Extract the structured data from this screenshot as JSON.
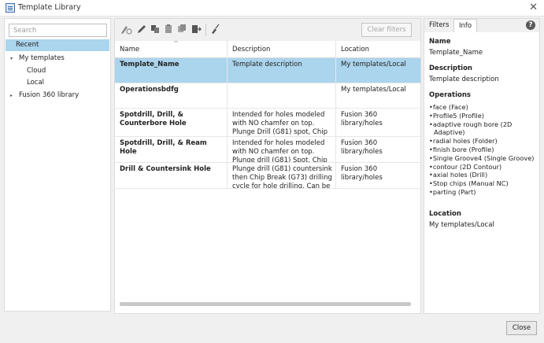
{
  "window": {
    "title": "Template Library",
    "close_glyph": "✕"
  },
  "search": {
    "placeholder": "Search",
    "value": ""
  },
  "tree": {
    "items": [
      {
        "label": "Recent",
        "selected": true
      },
      {
        "label": "My templates",
        "expander": "▾"
      },
      {
        "label": "Cloud"
      },
      {
        "label": "Local"
      },
      {
        "label": "Fusion 360 library",
        "expander": "▸"
      }
    ]
  },
  "toolbar": {
    "icons": [
      "select-tool-icon",
      "edit-icon",
      "copy-icon",
      "paste-icon",
      "duplicate-icon",
      "export-icon",
      "clear-icon"
    ],
    "clear_filters": "Clear filters"
  },
  "table": {
    "columns": [
      "Name",
      "Description",
      "Location"
    ],
    "sort_indicator": "^",
    "rows": [
      {
        "name": "Template_Name",
        "description": "Template description",
        "location": "My templates/Local",
        "selected": true
      },
      {
        "name": "Operationsbdfg",
        "description": "",
        "location": "My templates/Local"
      },
      {
        "name": "Spotdrill, Drill, & Counterbore Hole",
        "description": "Intended for holes modeled with NO chamfer on top. Plunge Drill (G81) spot, Chip Break (G73)",
        "location": "Fusion 360 library/holes"
      },
      {
        "name": "Spotdrill, Drill, & Ream Hole",
        "description": "Intended for holes modeled with NO chamfer on top. Plunge drill (G81) Spot, Chip Break (G73) Dri",
        "location": "Fusion 360 library/holes"
      },
      {
        "name": "Drill & Countersink Hole",
        "description": "Plunge drill (G81) countersink then Chip Break (G73) drilling cycle for hole drilling. Can be",
        "location": "Fusion 360 library/holes"
      }
    ]
  },
  "info_panel": {
    "tabs": [
      "Filters",
      "Info"
    ],
    "active_tab": "Info",
    "help_glyph": "?",
    "name_label": "Name",
    "name_value": "Template_Name",
    "description_label": "Description",
    "description_value": "Template description",
    "operations_label": "Operations",
    "operations": [
      "face (Face)",
      "Profile5 (Profile)",
      "adaptive rough bore (2D",
      "Adaptive)",
      "radial holes (Folder)",
      "finish bore (Profile)",
      "Single Groove4 (Single Groove)",
      "contour (2D Contour)",
      "axial holes (Drill)",
      "Stop chips (Manual NC)",
      "parting (Part)"
    ],
    "location_label": "Location",
    "location_value": "My templates/Local"
  },
  "footer": {
    "close_label": "Close"
  },
  "colors": {
    "selection": "#abd4ed",
    "panel_bg": "#f0f0f0",
    "border": "#dcdcdc"
  }
}
